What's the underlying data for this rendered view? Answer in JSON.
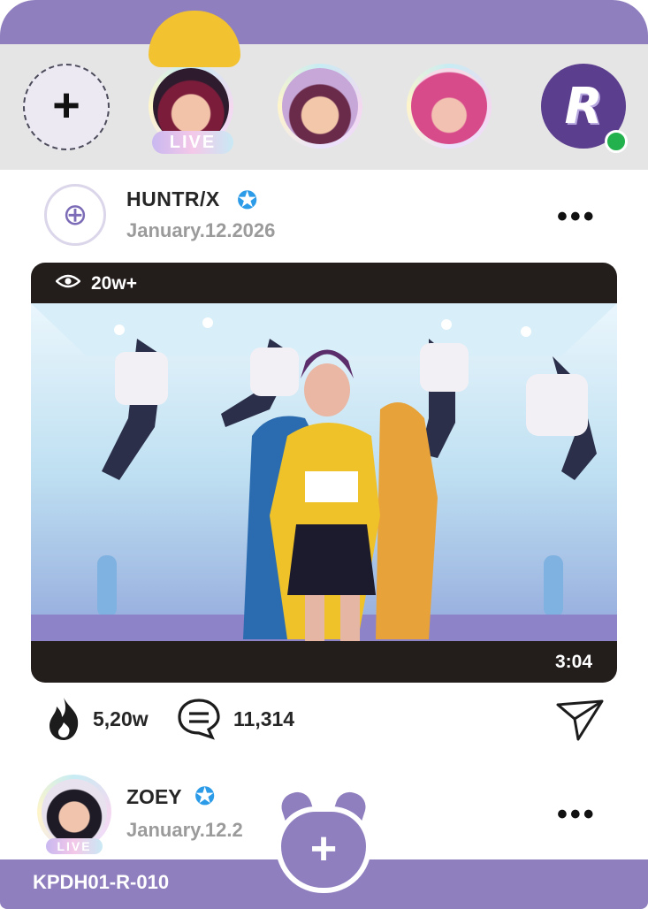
{
  "stories": {
    "add_label": "+",
    "live_label": "LIVE",
    "brand_letter": "R",
    "items": [
      {
        "name": "story-rumi-live",
        "live": true
      },
      {
        "name": "story-mira",
        "live": false
      },
      {
        "name": "story-pink-hood",
        "live": false
      },
      {
        "name": "story-brand",
        "online": true
      }
    ]
  },
  "post": {
    "author": "HUNTR/X",
    "date": "January.12.2026",
    "more": "•••",
    "views": "20w+",
    "duration": "3:04",
    "likes": "5,20w",
    "comments": "11,314"
  },
  "post2": {
    "author": "ZOEY",
    "date": "January.12.2",
    "more": "•••",
    "live_label": "LIVE"
  },
  "fab_label": "+",
  "card_code": "KPDH01-R-010",
  "colors": {
    "accent": "#8f7fbf",
    "verified": "#2c9be8",
    "online": "#22b14c",
    "media_bg": "#231d1c"
  }
}
